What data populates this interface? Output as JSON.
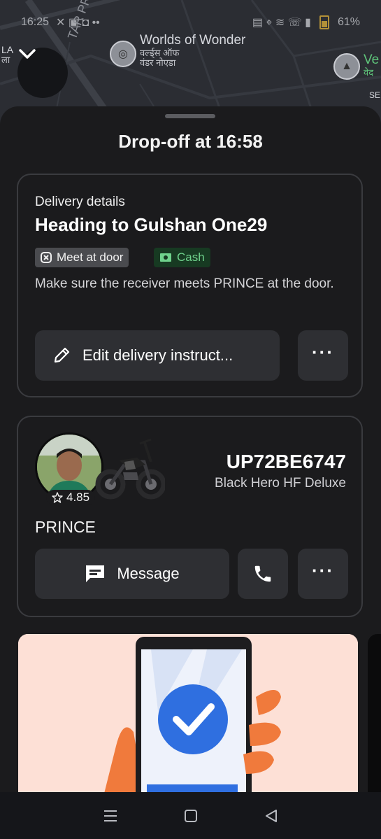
{
  "status_bar": {
    "time": "16:25",
    "battery": "61%"
  },
  "map": {
    "poi_worlds": {
      "name": "Worlds of Wonder",
      "sub_line1": "वर्ल्ड्स ऑफ",
      "sub_line2": "वंडर नोएडा"
    },
    "road_label": "TAR PRA",
    "left_edge_text": "LA",
    "left_edge_sub": "ला",
    "right_poi": {
      "name": "Ve",
      "sub": "वेद"
    },
    "right_edge_text": "SE"
  },
  "sheet": {
    "title": "Drop-off at 16:58"
  },
  "delivery": {
    "label": "Delivery details",
    "heading": "Heading to Gulshan One29",
    "tag_door": "Meet at door",
    "tag_cash": "Cash",
    "description": "Make sure the receiver meets PRINCE at the door.",
    "edit_button": "Edit delivery instruct..."
  },
  "driver": {
    "rating": "4.85",
    "plate": "UP72BE6747",
    "vehicle": "Black Hero HF Deluxe",
    "name": "PRINCE",
    "message_button": "Message"
  },
  "colors": {
    "sheet_bg": "#1b1b1d",
    "button_bg": "#2e2f33",
    "cash_green": "#6fd28c",
    "promo_blue": "#2f6fe0"
  },
  "icons": {
    "collapse": "chevron-down-icon",
    "door": "x-box-icon",
    "cash": "cash-icon",
    "edit": "pencil-icon",
    "more": "more-horizontal-icon",
    "star": "star-icon",
    "message": "message-icon",
    "call": "phone-icon"
  }
}
